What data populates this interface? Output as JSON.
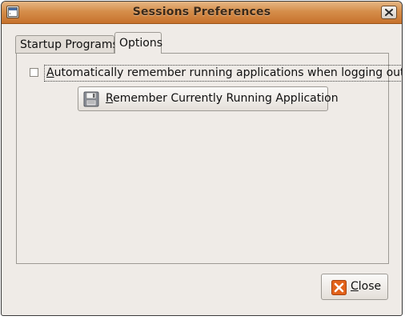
{
  "window": {
    "title": "Sessions Preferences",
    "menu_icon": "window-menu-icon",
    "close_icon": "close-icon"
  },
  "tabs": [
    {
      "label": "Startup Programs",
      "active": false
    },
    {
      "label": "Options",
      "active": true
    }
  ],
  "options": {
    "auto_remember": {
      "label_first": "A",
      "label_rest": "utomatically remember running applications when logging out",
      "checked": false
    },
    "remember_button": {
      "label_first": "R",
      "label_rest": "emember Currently Running Application",
      "icon": "floppy-disk-icon"
    }
  },
  "footer": {
    "close_button": {
      "label_first": "C",
      "label_rest": "lose",
      "icon": "close-x-icon"
    }
  },
  "colors": {
    "titlebar": "#d58e4b",
    "window_bg": "#efebe7",
    "close_icon_bg": "#e2621b"
  }
}
